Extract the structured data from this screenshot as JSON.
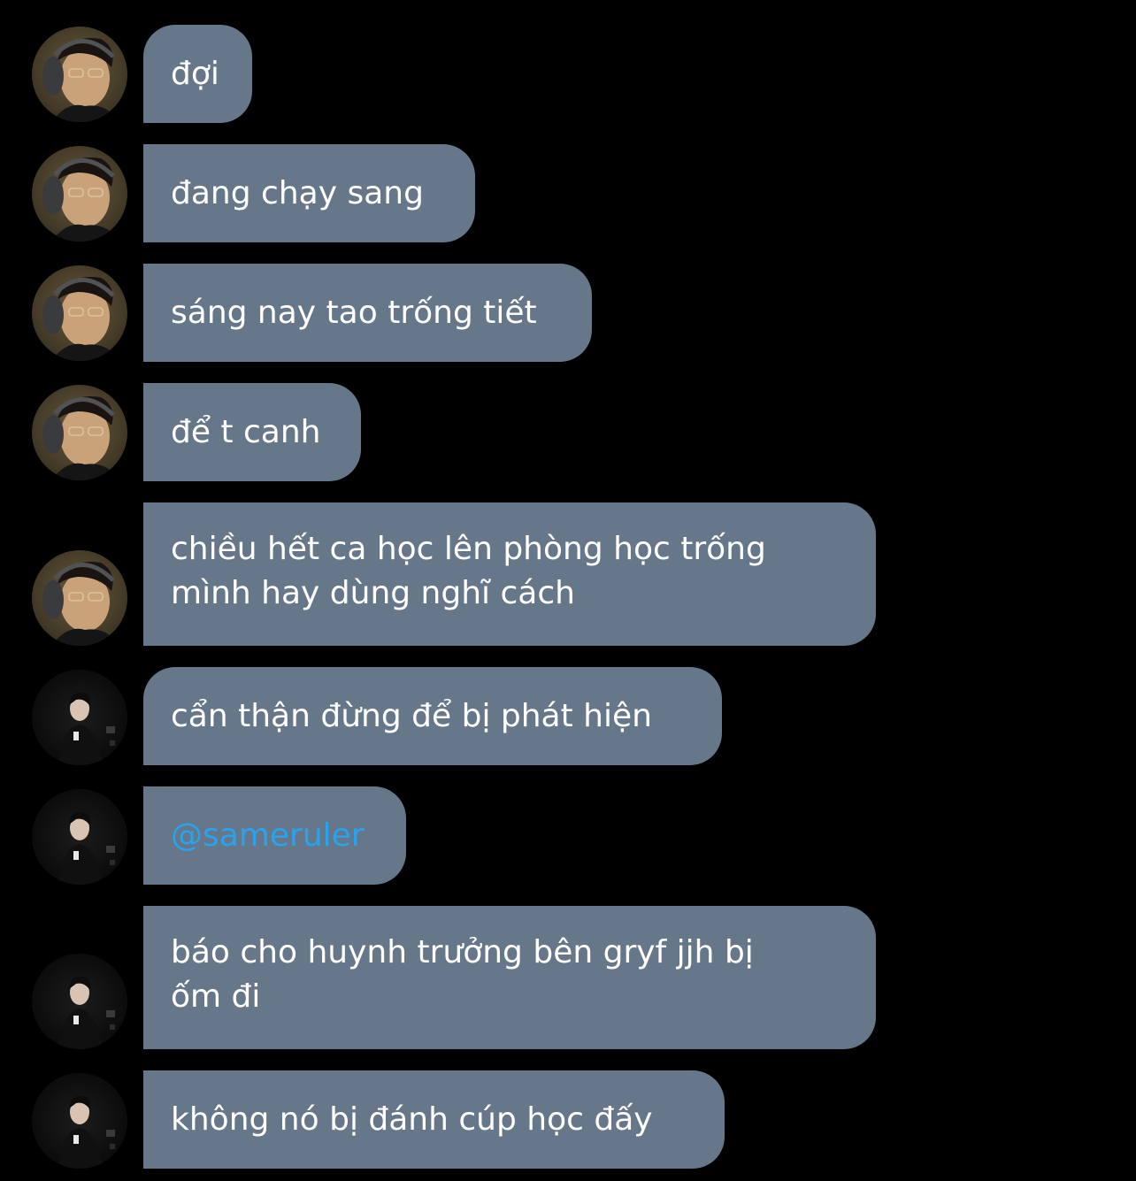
{
  "colors": {
    "background": "#000000",
    "bubble": "#66778a",
    "text": "#ffffff",
    "mention": "#2aa3ee"
  },
  "messages": [
    {
      "sender_avatar": "avatar-headphones",
      "text": "đợi"
    },
    {
      "sender_avatar": "avatar-headphones",
      "text": "đang chạy sang"
    },
    {
      "sender_avatar": "avatar-headphones",
      "text": "sáng nay tao trống tiết"
    },
    {
      "sender_avatar": "avatar-headphones",
      "text": "để t canh"
    },
    {
      "sender_avatar": "avatar-headphones",
      "text": "chiều hết ca học lên phòng học trống\nmình hay dùng nghĩ cách"
    },
    {
      "sender_avatar": "avatar-dark",
      "text": "cẩn thận đừng để bị phát hiện"
    },
    {
      "sender_avatar": "avatar-dark",
      "text": "@sameruler",
      "is_mention": true
    },
    {
      "sender_avatar": "avatar-dark",
      "text": "báo cho huynh trưởng bên gryf jjh bị\nốm đi"
    },
    {
      "sender_avatar": "avatar-dark",
      "text": "không nó bị đánh cúp học đấy"
    }
  ]
}
